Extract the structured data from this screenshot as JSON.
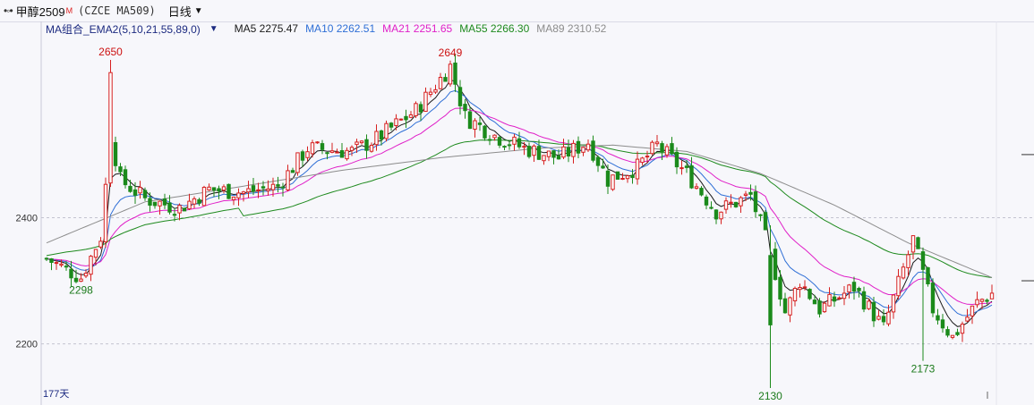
{
  "header": {
    "instrument_name": "甲醇2509",
    "badge": "M",
    "code": "(CZCE MA509)",
    "period": "日线"
  },
  "legend": {
    "indicator": "MA组合_EMA2(5,10,21,55,89,0)",
    "items": [
      {
        "label": "MA5 2275.47",
        "color": "#1a1a1a"
      },
      {
        "label": "MA10 2262.51",
        "color": "#2f6fd6"
      },
      {
        "label": "MA21 2251.65",
        "color": "#e020c8"
      },
      {
        "label": "MA55 2266.30",
        "color": "#1e8a1e"
      },
      {
        "label": "MA89 2310.52",
        "color": "#8c8c8c"
      }
    ]
  },
  "footer": {
    "bar_count": "177天"
  },
  "chart_data": {
    "type": "candlestick",
    "ylim": [
      2130,
      2660
    ],
    "y_ticks": [
      2200,
      2400
    ],
    "grid": "dashed-horizontal",
    "colors": {
      "up": "#d62020",
      "down": "#1b8a1b",
      "up_fill": "#ffffff"
    },
    "annotations": [
      {
        "label": "2650",
        "bar": 13,
        "value": 2650,
        "kind": "high",
        "color": "#cc1111"
      },
      {
        "label": "2649",
        "bar": 82,
        "value": 2649,
        "kind": "high",
        "color": "#cc1111"
      },
      {
        "label": "2298",
        "bar": 7,
        "value": 2298,
        "kind": "low",
        "color": "#1b7a1b"
      },
      {
        "label": "2130",
        "bar": 147,
        "value": 2130,
        "kind": "low",
        "color": "#1b7a1b"
      },
      {
        "label": "2173",
        "bar": 178,
        "value": 2173,
        "kind": "low",
        "color": "#1b7a1b"
      }
    ],
    "anchors": [
      [
        0,
        2335
      ],
      [
        7,
        2305
      ],
      [
        11,
        2370
      ],
      [
        13,
        2530
      ],
      [
        15,
        2460
      ],
      [
        20,
        2430
      ],
      [
        27,
        2415
      ],
      [
        33,
        2445
      ],
      [
        40,
        2440
      ],
      [
        47,
        2450
      ],
      [
        53,
        2510
      ],
      [
        62,
        2505
      ],
      [
        67,
        2525
      ],
      [
        75,
        2570
      ],
      [
        82,
        2640
      ],
      [
        85,
        2560
      ],
      [
        91,
        2530
      ],
      [
        97,
        2510
      ],
      [
        104,
        2495
      ],
      [
        110,
        2520
      ],
      [
        114,
        2460
      ],
      [
        120,
        2480
      ],
      [
        124,
        2515
      ],
      [
        130,
        2470
      ],
      [
        136,
        2410
      ],
      [
        143,
        2435
      ],
      [
        147,
        2345
      ],
      [
        150,
        2250
      ],
      [
        153,
        2300
      ],
      [
        157,
        2255
      ],
      [
        164,
        2290
      ],
      [
        170,
        2225
      ],
      [
        176,
        2365
      ],
      [
        180,
        2255
      ],
      [
        184,
        2210
      ],
      [
        189,
        2265
      ],
      [
        192,
        2280
      ]
    ],
    "moving_averages": [
      {
        "name": "MA5",
        "period": 5,
        "color": "#1a1a1a"
      },
      {
        "name": "MA10",
        "period": 10,
        "color": "#2f6fd6"
      },
      {
        "name": "MA21",
        "period": 21,
        "color": "#e020c8"
      },
      {
        "name": "MA55",
        "period": 55,
        "color": "#1e8a1e"
      },
      {
        "name": "MA89",
        "period": 89,
        "color": "#8c8c8c"
      }
    ],
    "ma89_seed": [
      [
        0,
        2360
      ],
      [
        20,
        2425
      ],
      [
        40,
        2450
      ],
      [
        60,
        2475
      ],
      [
        80,
        2495
      ],
      [
        100,
        2510
      ],
      [
        115,
        2515
      ],
      [
        130,
        2505
      ],
      [
        145,
        2470
      ],
      [
        160,
        2420
      ],
      [
        175,
        2360
      ],
      [
        192,
        2305
      ]
    ]
  }
}
